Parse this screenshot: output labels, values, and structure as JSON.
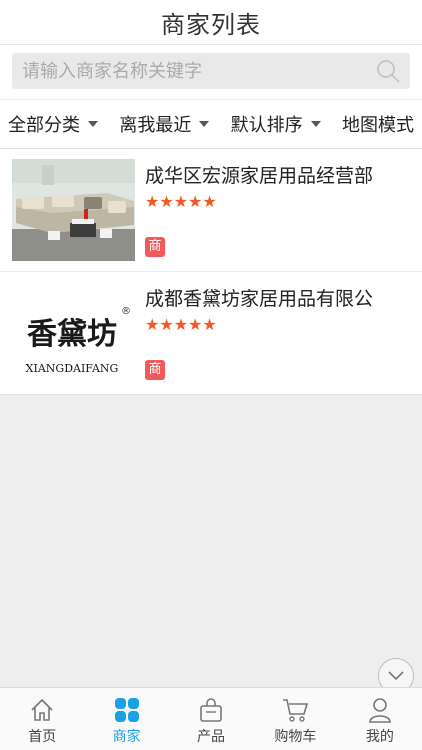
{
  "header": {
    "title": "商家列表"
  },
  "search": {
    "placeholder": "请输入商家名称关键字"
  },
  "filters": [
    {
      "label": "全部分类",
      "has_caret": true
    },
    {
      "label": "离我最近",
      "has_caret": true
    },
    {
      "label": "默认排序",
      "has_caret": true
    },
    {
      "label": "地图模式",
      "has_caret": false
    }
  ],
  "merchants": [
    {
      "name": "成华区宏源家居用品经营部",
      "rating": 5,
      "stars": "★★★★★",
      "badge": "商",
      "image": "sofa-photo"
    },
    {
      "name": "成都香黛坊家居用品有限公",
      "rating": 5,
      "stars": "★★★★★",
      "badge": "商",
      "image": "logo",
      "logo_text": "香黛坊",
      "logo_caption": "XIANGDAIFANG",
      "logo_mark": "®"
    }
  ],
  "tabbar": [
    {
      "label": "首页",
      "icon": "home-icon",
      "active": false
    },
    {
      "label": "商家",
      "icon": "grid-icon",
      "active": true
    },
    {
      "label": "产品",
      "icon": "bag-icon",
      "active": false
    },
    {
      "label": "购物车",
      "icon": "cart-icon",
      "active": false
    },
    {
      "label": "我的",
      "icon": "user-icon",
      "active": false
    }
  ],
  "colors": {
    "accent": "#1aa1e6",
    "star": "#f05a24",
    "badge": "#f05a5a"
  }
}
